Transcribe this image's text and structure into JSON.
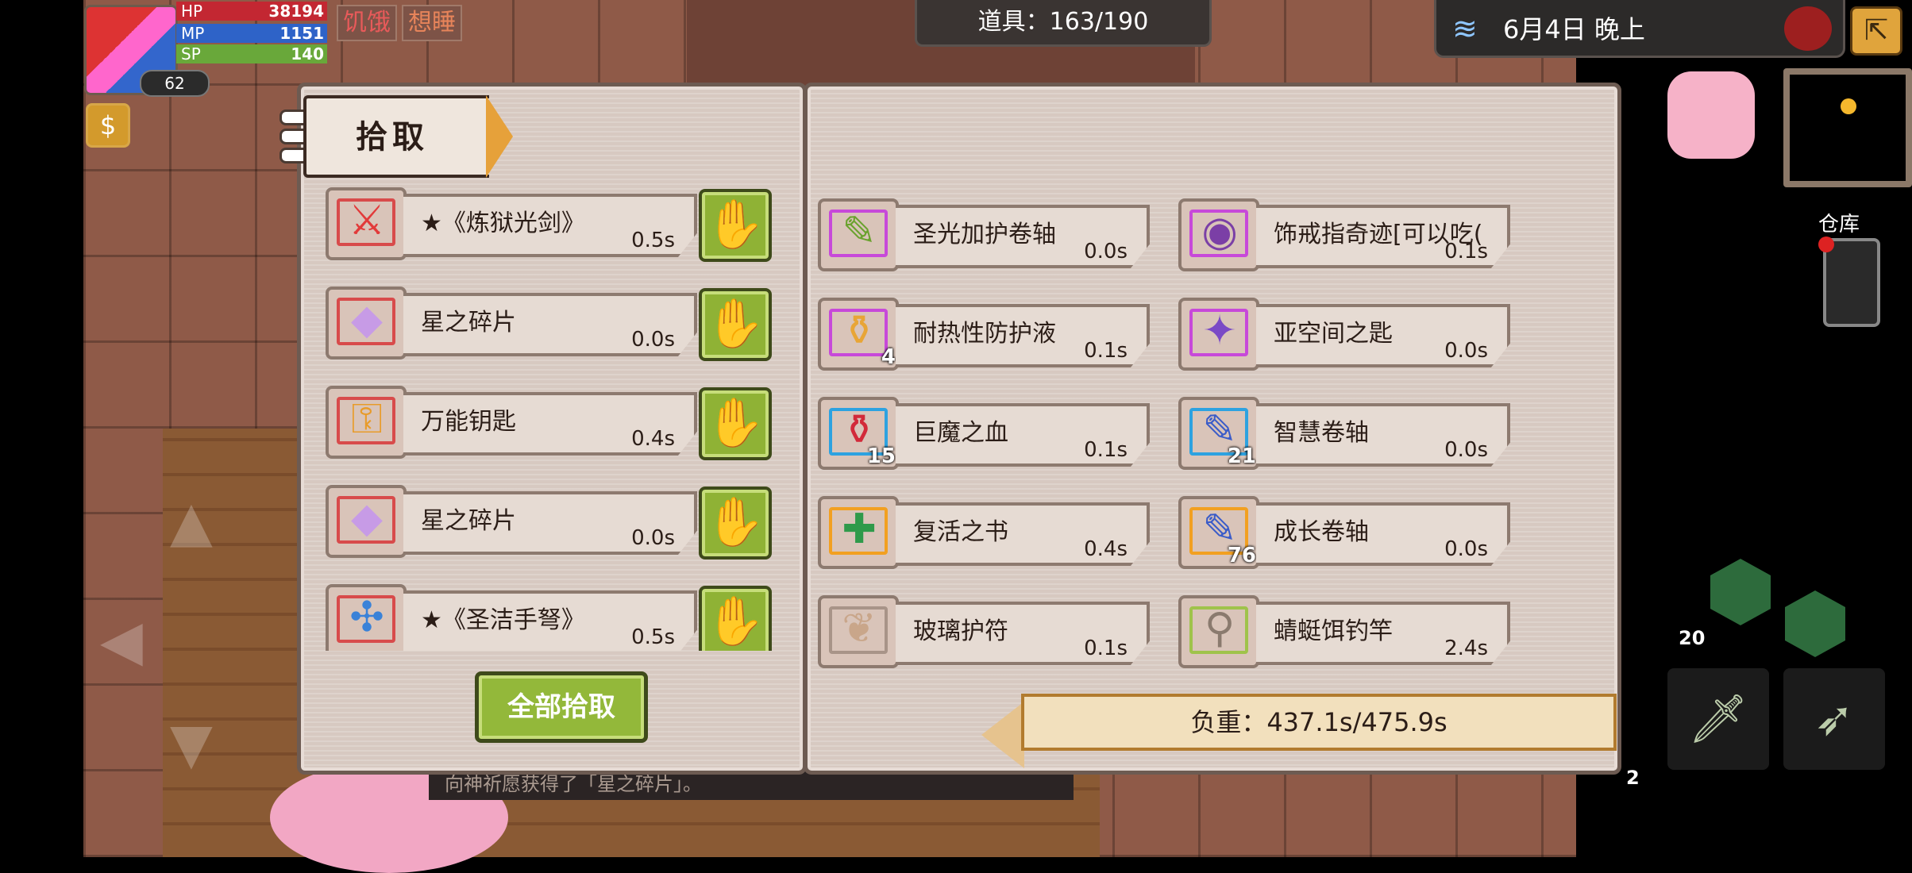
{
  "hud": {
    "hp_label": "HP",
    "hp_value": "38194",
    "mp_label": "MP",
    "mp_value": "1151",
    "sp_label": "SP",
    "sp_value": "140",
    "level": "62",
    "status_hungry": "饥饿",
    "status_sleepy": "想睡",
    "currency_icon": "coin-icon"
  },
  "top": {
    "items_count": "道具：163/190",
    "date": "6月4日 晚上",
    "warehouse": "仓库"
  },
  "loot": {
    "title": "拾取",
    "left_items": [
      {
        "name": "★《炼狱光剑》",
        "time": "0.5s",
        "icon": "⚔",
        "color": "#e23a3a",
        "frame": ""
      },
      {
        "name": "星之碎片",
        "time": "0.0s",
        "icon": "◆",
        "color": "#c79be6",
        "frame": ""
      },
      {
        "name": "万能钥匙",
        "time": "0.4s",
        "icon": "⚿",
        "color": "#e89b2a",
        "frame": ""
      },
      {
        "name": "星之碎片",
        "time": "0.0s",
        "icon": "◆",
        "color": "#c79be6",
        "frame": ""
      },
      {
        "name": "★《圣洁手弩》",
        "time": "0.5s",
        "icon": "✣",
        "color": "#3a82d8",
        "frame": ""
      }
    ],
    "right_items": [
      {
        "name": "圣光加护卷轴",
        "time": "0.0s",
        "qty": "",
        "icon": "✎",
        "color": "#6aa22e",
        "frame": "purple"
      },
      {
        "name": "饰戒指奇迹[可以吃(",
        "time": "0.1s",
        "qty": "",
        "icon": "◉",
        "color": "#7b3fa6",
        "frame": "purple"
      },
      {
        "name": "耐热性防护液",
        "time": "0.1s",
        "qty": "4",
        "icon": "⚱",
        "color": "#e8a536",
        "frame": "purple"
      },
      {
        "name": "亚空间之匙",
        "time": "0.0s",
        "qty": "",
        "icon": "✦",
        "color": "#7a4ac6",
        "frame": "purple"
      },
      {
        "name": "巨魔之血",
        "time": "0.1s",
        "qty": "15",
        "icon": "⚱",
        "color": "#d22a3a",
        "frame": "blue"
      },
      {
        "name": "智慧卷轴",
        "time": "0.0s",
        "qty": "21",
        "icon": "✎",
        "color": "#3b5cc8",
        "frame": "blue"
      },
      {
        "name": "复活之书",
        "time": "0.4s",
        "qty": "",
        "icon": "✚",
        "color": "#2f9a4a",
        "frame": "orange"
      },
      {
        "name": "成长卷轴",
        "time": "0.0s",
        "qty": "76",
        "icon": "✎",
        "color": "#3b5cc8",
        "frame": "orange"
      },
      {
        "name": "玻璃护符",
        "time": "0.1s",
        "qty": "",
        "icon": "❦",
        "color": "#c9a68a",
        "frame": "plain"
      },
      {
        "name": "蜻蜓饵钓竿",
        "time": "2.4s",
        "qty": "",
        "icon": "⚲",
        "color": "#8a7a6e",
        "frame": "green"
      }
    ],
    "pick_all": "全部拾取",
    "weight": "负重：437.1s/475.9s",
    "pick_icon": "hand-icon"
  },
  "chat": "向神祈愿获得了「星之碎片」。",
  "skill_counts": {
    "s1": "20",
    "s2": "2"
  }
}
